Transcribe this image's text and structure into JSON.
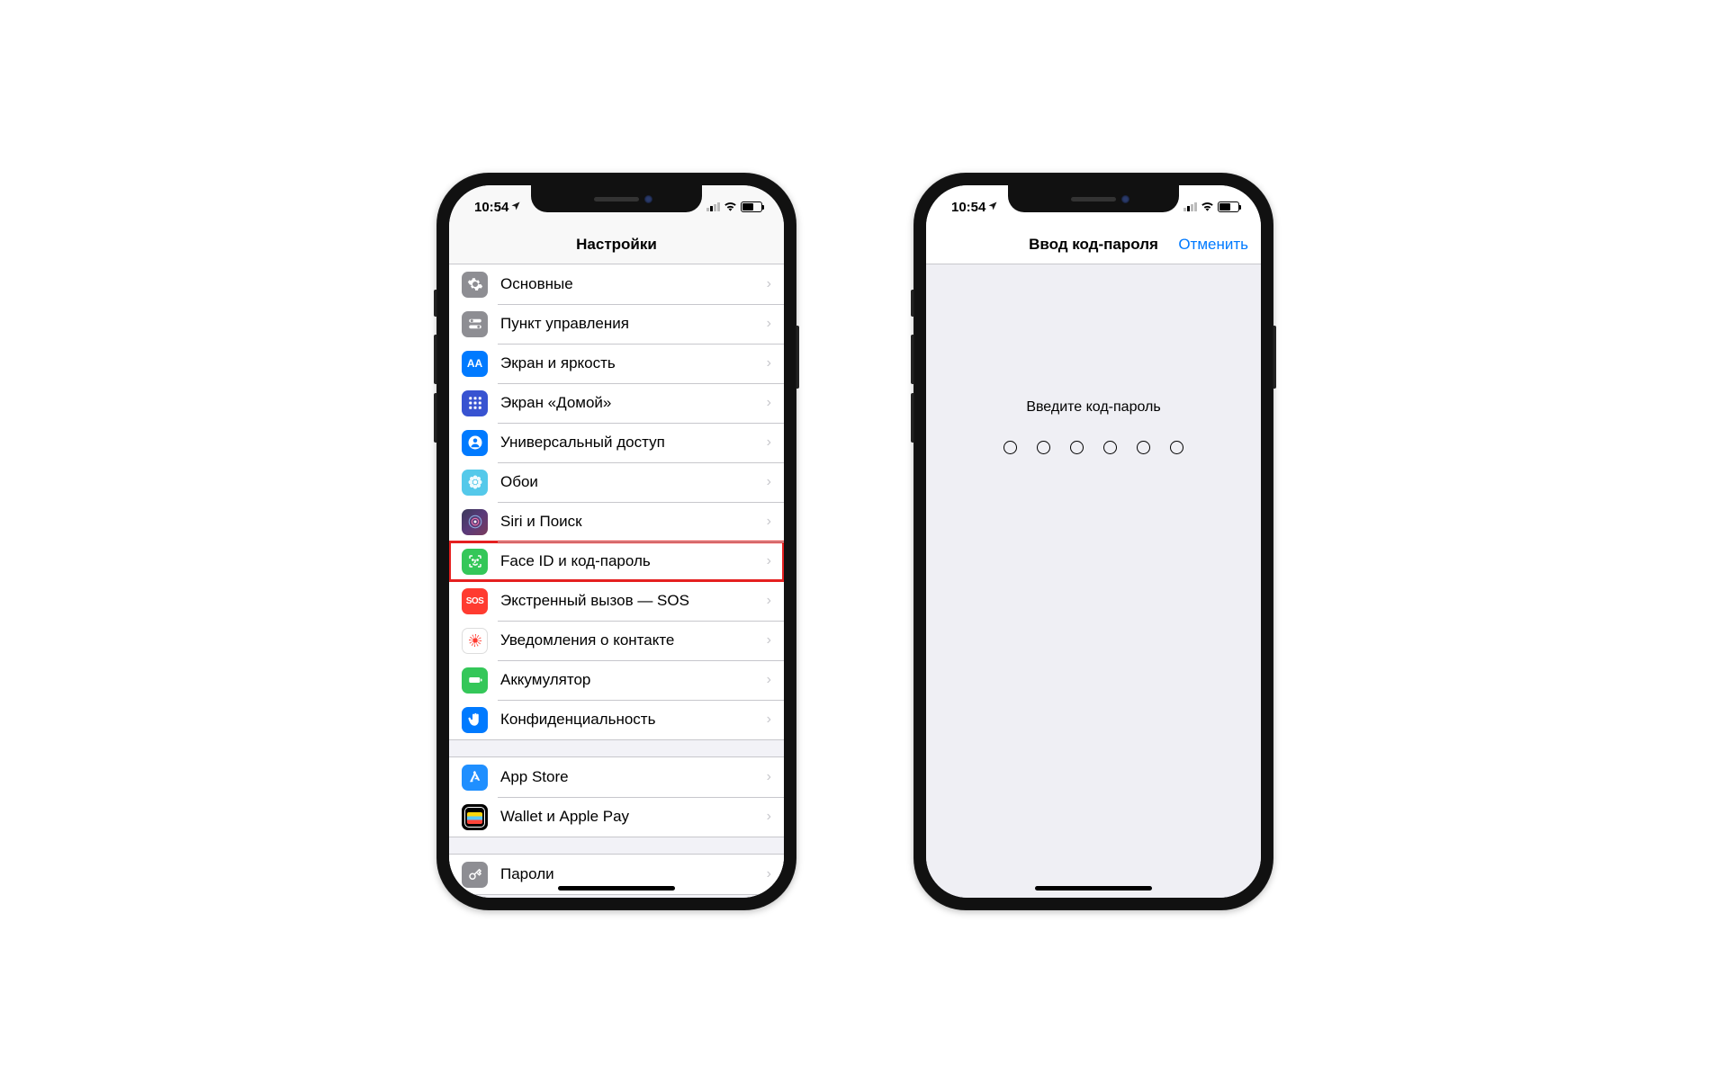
{
  "status": {
    "time": "10:54",
    "location_arrow": "➤"
  },
  "phone1": {
    "title": "Настройки",
    "items_g1": [
      {
        "label": "Основные",
        "icon": "gear",
        "bg": "bg-gray"
      },
      {
        "label": "Пункт управления",
        "icon": "switches",
        "bg": "bg-gray2"
      },
      {
        "label": "Экран и яркость",
        "icon": "aa",
        "bg": "bg-blue"
      },
      {
        "label": "Экран «Домой»",
        "icon": "grid",
        "bg": "bg-indigo"
      },
      {
        "label": "Универсальный доступ",
        "icon": "person",
        "bg": "bg-accessible"
      },
      {
        "label": "Обои",
        "icon": "flower",
        "bg": "bg-cyan"
      },
      {
        "label": "Siri и Поиск",
        "icon": "siri",
        "bg": "bg-siri"
      },
      {
        "label": "Face ID и код-пароль",
        "icon": "faceid",
        "bg": "bg-green",
        "highlighted": true
      },
      {
        "label": "Экстренный вызов — SOS",
        "icon": "sos",
        "bg": "bg-red"
      },
      {
        "label": "Уведомления о контакте",
        "icon": "exposure",
        "bg": "exposure"
      },
      {
        "label": "Аккумулятор",
        "icon": "battery",
        "bg": "bg-green"
      },
      {
        "label": "Конфиденциальность",
        "icon": "hand",
        "bg": "bg-privacy"
      }
    ],
    "items_g2": [
      {
        "label": "App Store",
        "icon": "appstore",
        "bg": "bg-appstore"
      },
      {
        "label": "Wallet и Apple Pay",
        "icon": "wallet",
        "bg": "bg-wallet"
      }
    ],
    "items_g3": [
      {
        "label": "Пароли",
        "icon": "key",
        "bg": "bg-keys"
      }
    ]
  },
  "phone2": {
    "title": "Ввод код-пароля",
    "cancel": "Отменить",
    "prompt": "Введите код-пароль",
    "digits": 6
  }
}
